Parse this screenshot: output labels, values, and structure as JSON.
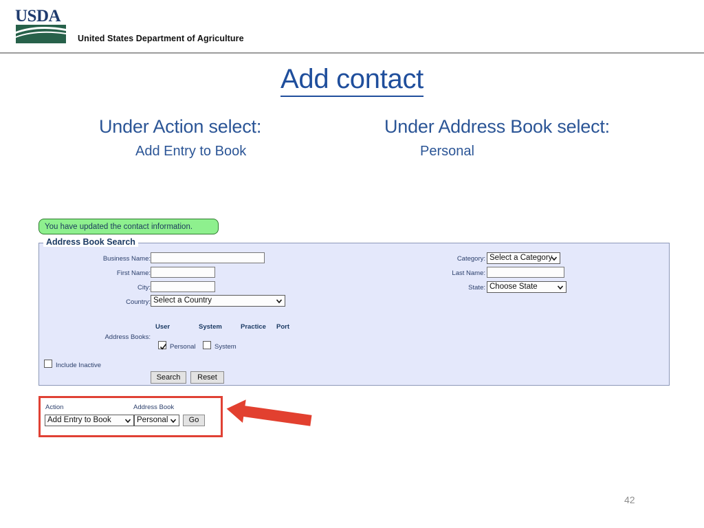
{
  "header": {
    "logo_text": "USDA",
    "agency_title": "United States Department of Agriculture"
  },
  "slide": {
    "title": "Add contact",
    "page_number": "42",
    "instructions": [
      {
        "heading": "Under Action select:",
        "value": "Add Entry to Book"
      },
      {
        "heading": "Under Address Book select:",
        "value": "Personal"
      }
    ]
  },
  "app": {
    "success_message": "You have updated the contact information.",
    "panel_legend": "Address Book Search",
    "fields": {
      "business_name": {
        "label": "Business Name:",
        "value": "",
        "placeholder": ""
      },
      "first_name": {
        "label": "First Name:",
        "value": "",
        "placeholder": ""
      },
      "city": {
        "label": "City:",
        "value": "",
        "placeholder": ""
      },
      "country": {
        "label": "Country:",
        "value": "Select a Country"
      },
      "category": {
        "label": "Category:",
        "value": "Select a Category"
      },
      "last_name": {
        "label": "Last Name:",
        "value": "",
        "placeholder": ""
      },
      "state": {
        "label": "State:",
        "value": "Choose State"
      }
    },
    "address_books": {
      "label": "Address Books:",
      "columns": [
        "User",
        "System",
        "Practice",
        "Port"
      ],
      "checkboxes": [
        {
          "label": "Personal",
          "checked": true
        },
        {
          "label": "System",
          "checked": false
        }
      ]
    },
    "include_inactive": {
      "label": "Include Inactive",
      "checked": false
    },
    "buttons": {
      "search": "Search",
      "reset": "Reset",
      "go": "Go"
    },
    "action_bar": {
      "action_label": "Action",
      "action_value": "Add Entry to Book",
      "book_label": "Address Book",
      "book_value": "Personal",
      "go_label": "Go"
    }
  },
  "colors": {
    "usda_navy": "#1f3b6e",
    "usda_green": "#27614a",
    "title_blue": "#1f4e9c",
    "subhead_blue": "#2b5596",
    "panel_bg": "#e4e8fb",
    "panel_border": "#8b97b8",
    "success_bg": "#8ef08e",
    "success_border": "#2d7a2d",
    "highlight_red": "#e04134"
  },
  "icons": {
    "chevron_down": "chevron-down-icon",
    "checkmark": "checkmark-icon",
    "arrow_left": "arrow-left-icon"
  }
}
